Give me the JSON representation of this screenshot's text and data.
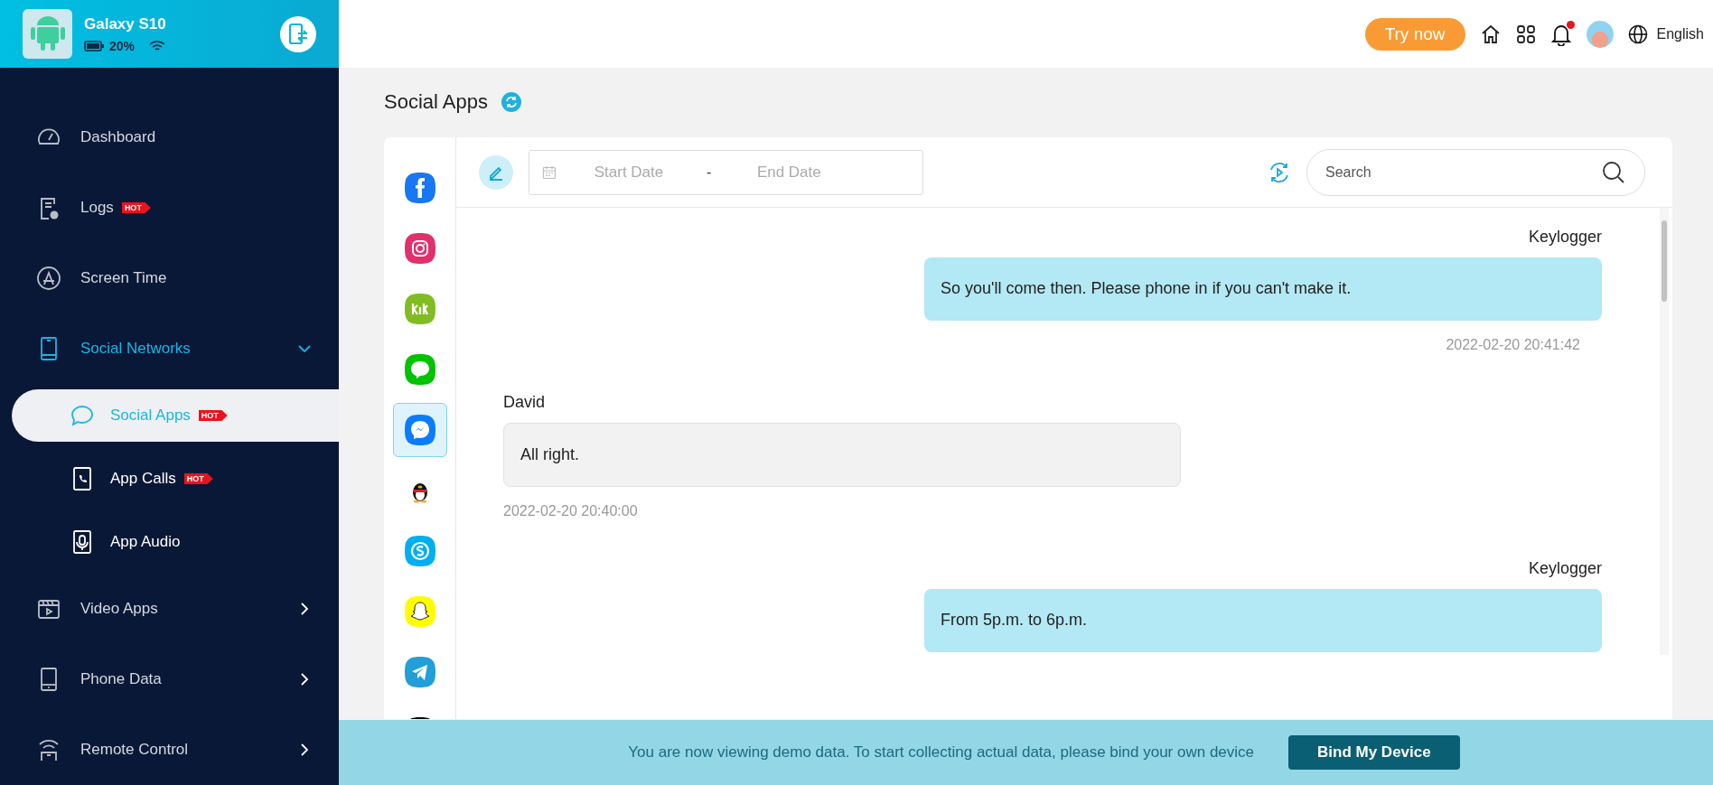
{
  "device": {
    "name": "Galaxy S10",
    "battery": "20%"
  },
  "sidebar": {
    "items": [
      {
        "label": "Dashboard",
        "selected": false
      },
      {
        "label": "Logs",
        "hot": "HOT",
        "selected": false
      },
      {
        "label": "Screen Time",
        "selected": false
      },
      {
        "label": "Social Networks",
        "selected": false,
        "expanded": true,
        "children": [
          {
            "label": "Social Apps",
            "hot": "HOT",
            "selected": true
          },
          {
            "label": "App Calls",
            "hot": "HOT",
            "selected": false
          },
          {
            "label": "App Audio",
            "selected": false
          }
        ]
      },
      {
        "label": "Video Apps",
        "selected": false,
        "expanded": false
      },
      {
        "label": "Phone Data",
        "selected": false,
        "expanded": false
      },
      {
        "label": "Remote Control",
        "selected": false,
        "expanded": false
      }
    ]
  },
  "topbar": {
    "try_button": "Try now",
    "notification_unread": true,
    "language": "English"
  },
  "page_title": "Social Apps",
  "apps": [
    {
      "selected": false
    },
    {
      "selected": false
    },
    {
      "selected": false
    },
    {
      "selected": false
    },
    {
      "selected": true
    },
    {
      "selected": false
    },
    {
      "selected": false
    },
    {
      "selected": false
    },
    {
      "selected": false
    },
    {
      "selected": false
    }
  ],
  "filter": {
    "start_placeholder": "Start Date",
    "separator": "-",
    "end_placeholder": "End Date",
    "search_placeholder": "Search"
  },
  "messages": [
    {
      "kind": "sent",
      "sender": "Keylogger",
      "text": "So you'll come then. Please phone in if you can't make it.",
      "time": "2022-02-20 20:41:42"
    },
    {
      "kind": "received",
      "sender": "David",
      "text": "All right.",
      "time": "2022-02-20 20:40:00"
    },
    {
      "kind": "sent",
      "sender": "Keylogger",
      "text": "From 5p.m. to 6p.m."
    }
  ],
  "banner": {
    "text": "You are now viewing demo data. To start collecting actual data, please bind your own device",
    "button": "Bind My Device"
  }
}
